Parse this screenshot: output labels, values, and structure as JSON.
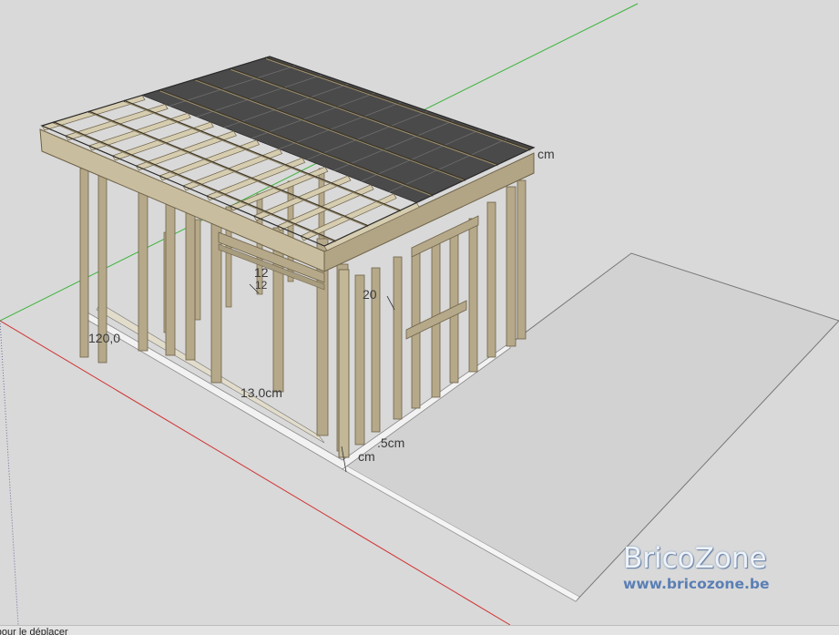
{
  "viewport": {
    "colors": {
      "background": "#d9d9d9",
      "ground_slab": "#d2d2d2",
      "timber": "#b5a98a",
      "timber_dark": "#6d6148",
      "roof_panel": "#4a4a4a",
      "axis_red": "#d23232",
      "axis_green": "#3cb43c"
    },
    "dimensions": {
      "d1": "12",
      "d2": "120,0",
      "d3": "12",
      "d4": "20",
      "d5": "13.0cm",
      "d6": "cm",
      "d7": ".5cm",
      "d8": "cm"
    }
  },
  "watermark": {
    "title": "BricoZone",
    "url": "www.bricozone.be"
  },
  "status_bar": {
    "text": "rt pour le déplacer"
  }
}
